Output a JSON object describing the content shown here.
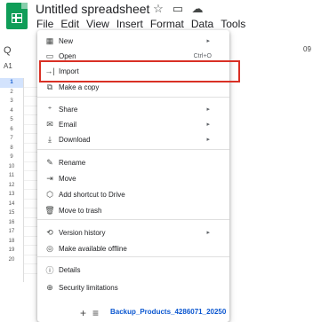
{
  "header": {
    "doc_title": "Untitled spreadsheet",
    "icons": [
      "star-icon",
      "folder-icon",
      "cloud-icon"
    ],
    "menus": [
      "File",
      "Edit",
      "View",
      "Insert",
      "Format",
      "Data",
      "Tools"
    ]
  },
  "toolbar": {
    "search_icon": "Q",
    "cell_ref": "A1",
    "zoom_fragment": "09"
  },
  "row_numbers": [
    "1",
    "2",
    "3",
    "4",
    "5",
    "6",
    "7",
    "8",
    "9",
    "10",
    "11",
    "12",
    "13",
    "14",
    "15",
    "16",
    "17",
    "18",
    "19",
    "20"
  ],
  "selected_row": "1",
  "file_menu": {
    "items": [
      {
        "icon": "▦",
        "label": "New",
        "shortcut": "",
        "submenu": true
      },
      {
        "icon": "▭",
        "label": "Open",
        "shortcut": "Ctrl+O",
        "submenu": false
      },
      {
        "icon": "→|",
        "label": "Import",
        "shortcut": "",
        "submenu": false
      },
      {
        "icon": "⧉",
        "label": "Make a copy",
        "shortcut": "",
        "submenu": false
      },
      {
        "icon": "⁺",
        "label": "Share",
        "shortcut": "",
        "submenu": true
      },
      {
        "icon": "✉",
        "label": "Email",
        "shortcut": "",
        "submenu": true
      },
      {
        "icon": "⤓",
        "label": "Download",
        "shortcut": "",
        "submenu": true
      },
      {
        "icon": "✎",
        "label": "Rename",
        "shortcut": "",
        "submenu": false
      },
      {
        "icon": "⇥",
        "label": "Move",
        "shortcut": "",
        "submenu": false
      },
      {
        "icon": "⬡",
        "label": "Add shortcut to Drive",
        "shortcut": "",
        "submenu": false
      },
      {
        "icon": "🗑",
        "label": "Move to trash",
        "shortcut": "",
        "submenu": false
      },
      {
        "icon": "⟲",
        "label": "Version history",
        "shortcut": "",
        "submenu": true
      },
      {
        "icon": "◎",
        "label": "Make available offline",
        "shortcut": "",
        "submenu": false
      },
      {
        "icon": "ⓘ",
        "label": "Details",
        "shortcut": "",
        "submenu": false
      },
      {
        "icon": "⊕",
        "label": "Security limitations",
        "shortcut": "",
        "submenu": false
      }
    ],
    "highlighted_item": "Import"
  },
  "bottom_bar": {
    "add_sheet": "+",
    "all_sheets": "≡",
    "sheet_tab": "Backup_Products_4286071_20250"
  },
  "colors": {
    "accent": "#0b57d0",
    "highlight_border": "#d93025",
    "logo": "#0f9d58"
  }
}
